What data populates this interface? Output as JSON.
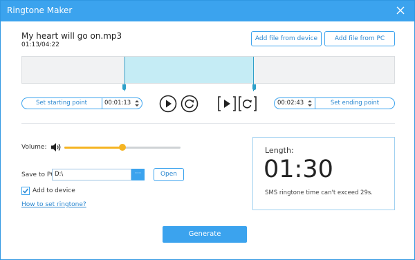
{
  "window": {
    "title": "Ringtone Maker"
  },
  "file": {
    "name": "My heart will go on.mp3",
    "time": "01:13/04:22"
  },
  "buttons": {
    "add_from_device": "Add file from device",
    "add_from_pc": "Add file from PC",
    "open": "Open",
    "browse": "···",
    "generate": "Generate"
  },
  "trim": {
    "selection_start_fraction": 0.276,
    "selection_end_fraction": 0.621,
    "set_start_label": "Set starting point",
    "start_time": "00:01:13",
    "end_time": "00:02:43",
    "set_end_label": "Set ending point"
  },
  "settings": {
    "volume_label": "Volume:",
    "volume_level": 0.5,
    "save_label": "Save to PC:",
    "save_path": "D:\\",
    "add_to_device_label": "Add to device",
    "add_to_device_checked": true,
    "help_link": "How to set ringtone?"
  },
  "length": {
    "title": "Length:",
    "value": "01:30",
    "note": "SMS ringtone time can't exceed 29s."
  },
  "colors": {
    "accent": "#3ba3ee",
    "volume": "#f5b422",
    "selection": "#c5ecf5"
  },
  "icons": [
    "close-icon",
    "play-icon",
    "replay-icon",
    "play-segment-icon",
    "replay-segment-icon",
    "volume-icon",
    "checkmark-icon"
  ]
}
